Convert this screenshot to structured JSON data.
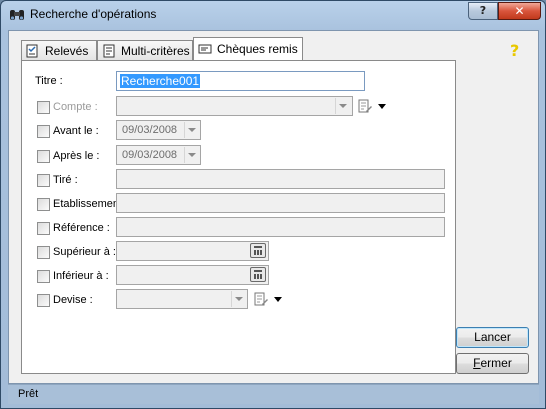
{
  "window": {
    "title": "Recherche d'opérations",
    "help_button": "?",
    "close_button": "✕"
  },
  "tabs": [
    {
      "label": "Relevés",
      "icon": "checklist-icon"
    },
    {
      "label": "Multi-critères",
      "icon": "document-icon"
    },
    {
      "label": "Chèques remis",
      "icon": "cheque-icon",
      "active": true
    }
  ],
  "help_icon": "?",
  "form": {
    "titre": {
      "label": "Titre :",
      "value": "Recherche001"
    },
    "compte": {
      "label": "Compte :",
      "value": ""
    },
    "avant": {
      "label": "Avant le :",
      "value": "09/03/2008"
    },
    "apres": {
      "label": "Après le :",
      "value": "09/03/2008"
    },
    "tire": {
      "label": "Tiré :",
      "value": ""
    },
    "etablissement": {
      "label": "Etablissement :",
      "value": ""
    },
    "reference": {
      "label": "Référence :",
      "value": ""
    },
    "superieur": {
      "label": "Supérieur à :",
      "value": ""
    },
    "inferieur": {
      "label": "Inférieur à :",
      "value": ""
    },
    "devise": {
      "label": "Devise :",
      "value": ""
    }
  },
  "buttons": {
    "lancer": "Lancer",
    "fermer_first": "F",
    "fermer_rest": "ermer"
  },
  "status": {
    "text": "Prêt"
  },
  "colors": {
    "selection": "#3399ff",
    "help": "#e8c800",
    "close": "#c0391c"
  }
}
